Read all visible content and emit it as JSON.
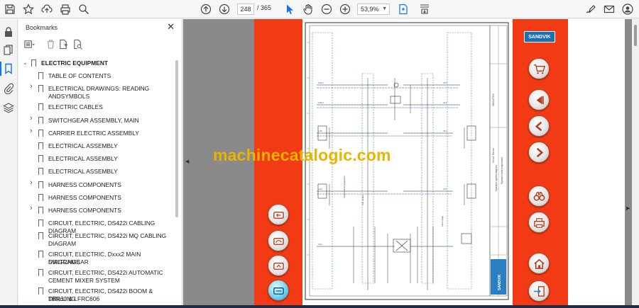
{
  "toolbar": {
    "page_current": "248",
    "page_separator": "/ 365",
    "zoom": "53,9%",
    "icons": [
      "save-icon",
      "star-icon",
      "upload-icon",
      "print-icon",
      "search-icon",
      "page-up-icon",
      "page-down-icon",
      "select-cursor-icon",
      "hand-icon",
      "zoom-out-icon",
      "zoom-in-icon",
      "fit-page-icon",
      "scroll-mode-icon",
      "edit-sign-icon",
      "mail-icon",
      "account-icon"
    ]
  },
  "rail": {
    "icons": [
      "lock-icon",
      "pages-icon",
      "bookmark-icon",
      "attachment-icon",
      "layers-icon"
    ]
  },
  "bookmarks": {
    "title": "Bookmarks",
    "items": [
      {
        "label": "ELECTRIC EQUIPMENT",
        "level": 0,
        "expanded": true
      },
      {
        "label": "TABLE OF CONTENTS",
        "level": 1,
        "has_children": false
      },
      {
        "label": "ELECTRICAL DRAWINGS: READING",
        "label2": "ANDSYMBOLS",
        "level": 1,
        "has_children": true
      },
      {
        "label": "ELECTRIC CABLES",
        "level": 1,
        "has_children": false
      },
      {
        "label": "SWITCHGEAR ASSEMBLY, MAIN",
        "level": 1,
        "has_children": true
      },
      {
        "label": "CARRIER ELECTRIC ASSEMBLY",
        "level": 1,
        "has_children": true
      },
      {
        "label": "ELECTRICAL ASSEMBLY",
        "level": 1,
        "has_children": false
      },
      {
        "label": "ELECTRICAL ASSEMBLY",
        "level": 1,
        "has_children": false
      },
      {
        "label": "ELECTRICAL ASSEMBLY",
        "level": 1,
        "has_children": false
      },
      {
        "label": "HARNESS COMPONENTS",
        "level": 1,
        "has_children": true
      },
      {
        "label": "HARNESS COMPONENTS",
        "level": 1,
        "has_children": false
      },
      {
        "label": "HARNESS COMPONENTS",
        "level": 1,
        "has_children": true
      },
      {
        "label": "CIRCUIT, ELECTRIC, DS422i CABLING DIAGRAM",
        "level": 1,
        "has_children": false
      },
      {
        "label": "CIRCUIT, ELECTRIC, DS422i MQ CABLING",
        "label2": "DIAGRAM",
        "level": 1,
        "has_children": false
      },
      {
        "label": "CIRCUIT, ELECTRIC, Dxxx2 MAIN SWITCHGEAR",
        "label2": "DIAGRAMS",
        "level": 1,
        "has_children": false
      },
      {
        "label": "CIRCUIT, ELECTRIC, DS422i AUTOMATIC",
        "label2": "CEMENT MIXER SYSTEM",
        "level": 1,
        "has_children": false
      },
      {
        "label": "CIRCUIT, ELECTRIC, DS422i BOOM & DRILLING",
        "label2": "TBR60 & LFRC606",
        "level": 1,
        "has_children": false
      }
    ]
  },
  "document": {
    "watermark": "machinecatalogic.com",
    "brand": "SANDVIK",
    "schematic_brand": "SANDVIK",
    "nav_buttons_left": [
      "back-page-button",
      "history-button",
      "print-page-button",
      "current-page-button"
    ],
    "nav_buttons_right": [
      "shopping-cart-button",
      "first-page-button",
      "previous-page-button",
      "next-page-button",
      "binoculars-button",
      "printer-button",
      "home-button",
      "exit-button"
    ]
  },
  "colors": {
    "accent": "#f23b15",
    "brand_blue": "#1b6fb8",
    "watermark": "#e8b400",
    "active_blue": "#1473e6"
  }
}
